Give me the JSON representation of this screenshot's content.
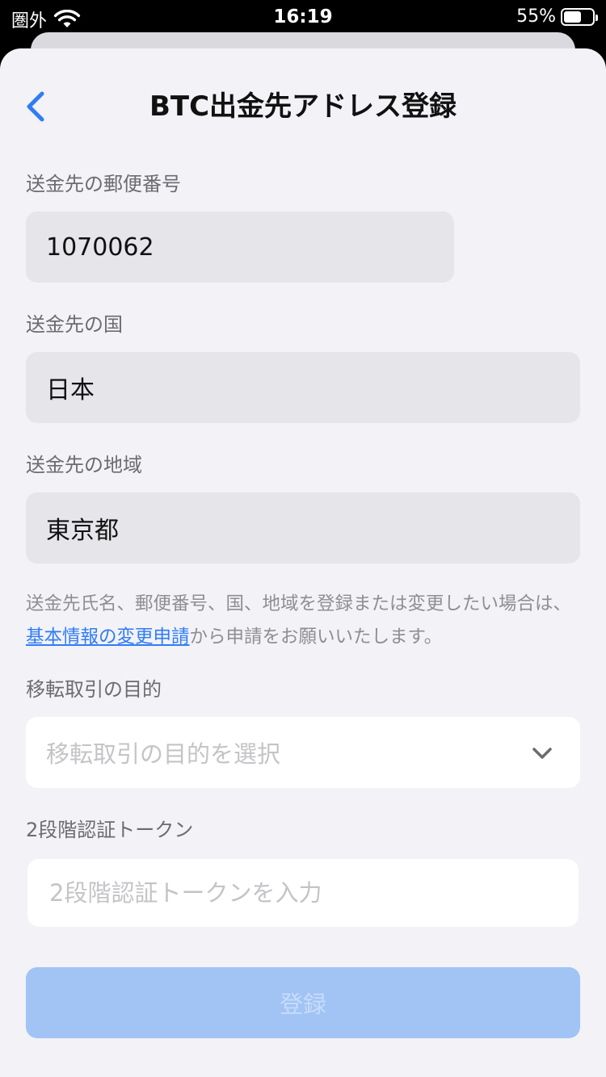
{
  "status_bar": {
    "carrier": "圏外",
    "time": "16:19",
    "battery": "55%",
    "wifi_icon": "wifi-icon",
    "battery_icon": "battery-icon"
  },
  "header": {
    "title": "BTC出金先アドレス登録",
    "back_icon": "chevron-left-icon"
  },
  "form": {
    "postal_code": {
      "label": "送金先の郵便番号",
      "value": "1070062"
    },
    "country": {
      "label": "送金先の国",
      "value": "日本"
    },
    "region": {
      "label": "送金先の地域",
      "value": "東京都"
    },
    "notice": {
      "text_before": "送金先氏名、郵便番号、国、地域を登録または変更したい場合は、",
      "link": "基本情報の変更申請",
      "text_after": "から申請をお願いいたします。"
    },
    "purpose": {
      "label": "移転取引の目的",
      "placeholder": "移転取引の目的を選択"
    },
    "token": {
      "label": "2段階認証トークン",
      "placeholder": "2段階認証トークンを入力"
    },
    "submit_label": "登録"
  },
  "colors": {
    "accent": "#2f7cf6",
    "submit_disabled": "#a1c4f5",
    "field_readonly": "#e5e5ea",
    "background": "#f2f2f7"
  }
}
